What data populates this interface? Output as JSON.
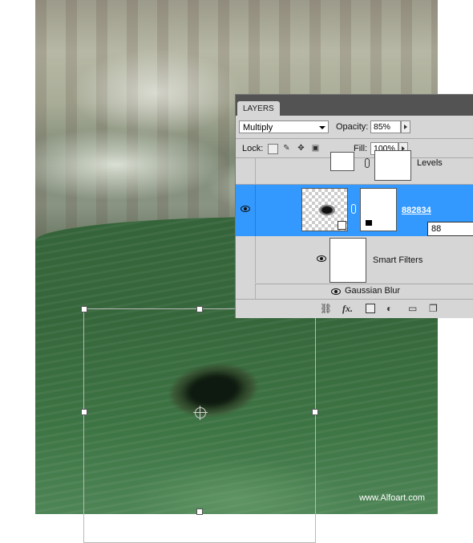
{
  "watermark": "www.Alfoart.com",
  "layers_panel": {
    "tab_label": "LAYERS",
    "blend_mode": "Multiply",
    "opacity_label": "Opacity:",
    "opacity_value": "85%",
    "lock_label": "Lock:",
    "fill_label": "Fill:",
    "fill_value": "100%",
    "layers": [
      {
        "name": "Levels",
        "selected": false
      },
      {
        "name": "882834",
        "selected": true,
        "tooltip": "88"
      },
      {
        "name": "Smart Filters",
        "selected": false
      },
      {
        "name": "Gaussian Blur",
        "selected": false
      }
    ],
    "bottom_icons": [
      "link-layers-icon",
      "fx-icon",
      "add-mask-icon",
      "adjustment-layer-icon",
      "new-group-icon",
      "new-layer-icon"
    ],
    "fx_label": "fx."
  },
  "colors": {
    "selected_row": "#3399ff",
    "panel_bg": "#d6d6d6",
    "tab_bar": "#535353",
    "water": "#36673b"
  }
}
